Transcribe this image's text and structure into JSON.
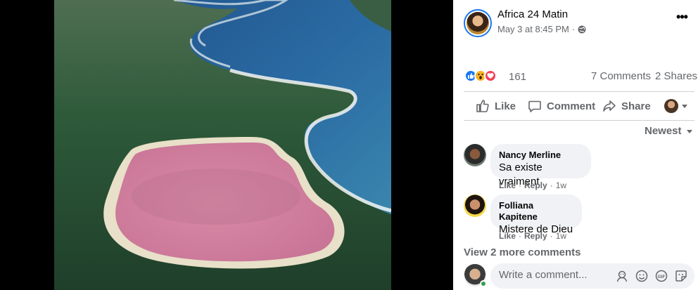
{
  "post": {
    "page_name": "Africa 24 Matin",
    "timestamp": "May 3 at 8:45 PM",
    "separator": "·",
    "more_label": "•••",
    "reactions_count": "161",
    "comments_count": "7 Comments",
    "shares_count": "2 Shares"
  },
  "actions": {
    "like": "Like",
    "comment": "Comment",
    "share": "Share"
  },
  "sort": {
    "label": "Newest"
  },
  "comments": [
    {
      "author": "Nancy Merline",
      "text": "Sa existe vraiment",
      "like": "Like",
      "reply": "Reply",
      "dot": "·",
      "age": "1w"
    },
    {
      "author": "Folliana Kapitene",
      "text": "Mistere de Dieu",
      "like": "Like",
      "reply": "Reply",
      "dot": "·",
      "age": "1w"
    }
  ],
  "view_more": "View 2 more comments",
  "composer": {
    "placeholder": "Write a comment..."
  },
  "colors": {
    "accent": "#1877f2",
    "text_secondary": "#65676b",
    "bubble_bg": "#f0f2f5",
    "online": "#31a24c"
  }
}
